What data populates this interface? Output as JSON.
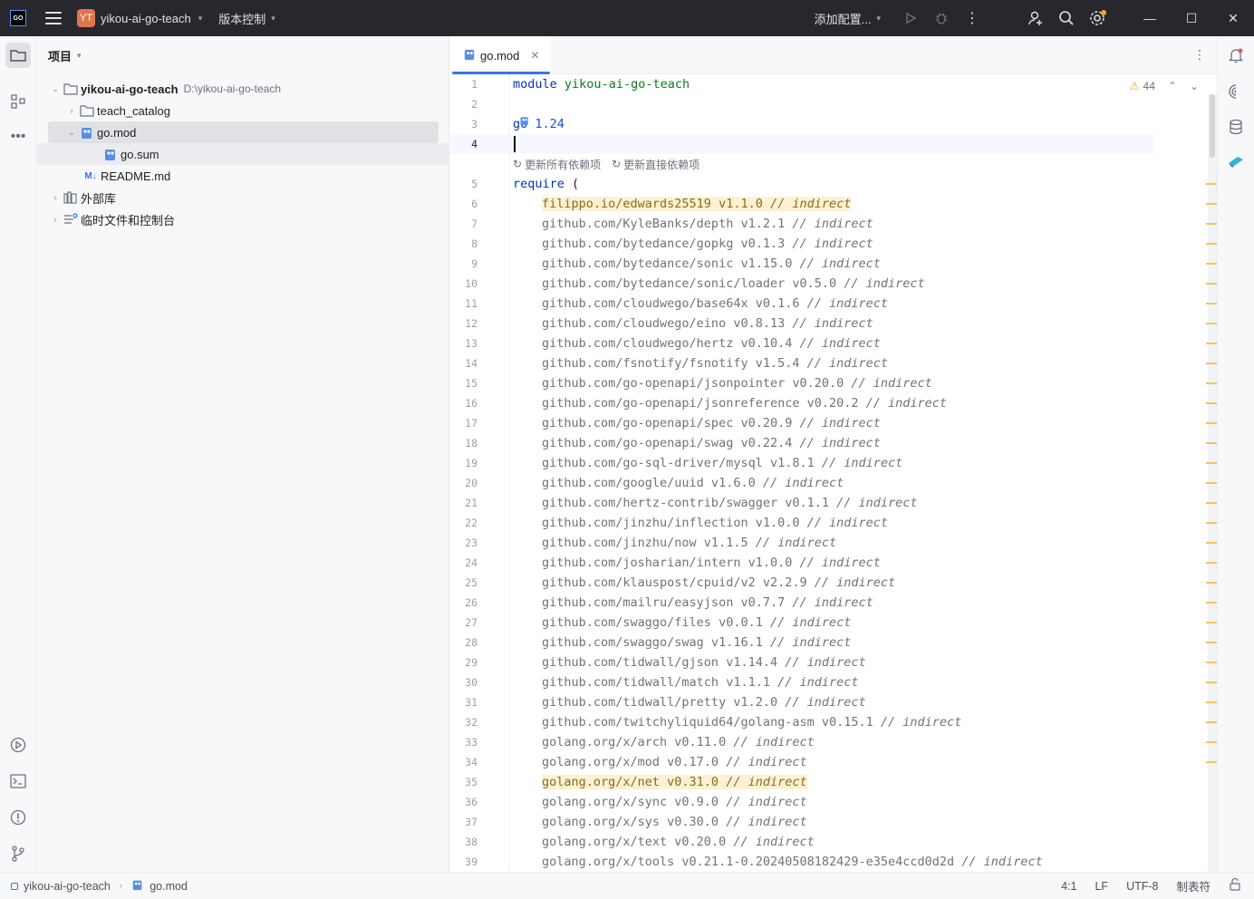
{
  "titlebar": {
    "project_badge": "YT",
    "project_name": "yikou-ai-go-teach",
    "vcs_label": "版本控制",
    "run_config": "添加配置..."
  },
  "project_panel": {
    "title": "项目",
    "root": {
      "name": "yikou-ai-go-teach",
      "path": "D:\\yikou-ai-go-teach"
    },
    "items": [
      {
        "label": "teach_catalog"
      },
      {
        "label": "go.mod"
      },
      {
        "label": "go.sum"
      },
      {
        "label": "README.md"
      },
      {
        "label": "外部库"
      },
      {
        "label": "临时文件和控制台"
      }
    ]
  },
  "editor": {
    "tab_label": "go.mod",
    "warning_count": "44",
    "inlay_actions": [
      "更新所有依赖项",
      "更新直接依赖项"
    ],
    "line_numbers": [
      "1",
      "2",
      "3",
      "4",
      "5",
      "6",
      "7",
      "8",
      "9",
      "10",
      "11",
      "12",
      "13",
      "14",
      "15",
      "16",
      "17",
      "18",
      "19",
      "20",
      "21",
      "22",
      "23",
      "24",
      "25",
      "26",
      "27",
      "28",
      "29",
      "30",
      "31",
      "32",
      "33",
      "34",
      "35",
      "36",
      "37",
      "38",
      "39"
    ],
    "module_keyword": "module",
    "module_name": "yikou-ai-go-teach",
    "go_keyword": "go",
    "go_version": "1.24",
    "require_keyword": "require",
    "require_paren": "(",
    "comment": "// indirect",
    "dependencies": [
      {
        "mod": "filippo.io/edwards25519 v1.1.0",
        "highlight": true
      },
      {
        "mod": "github.com/KyleBanks/depth v1.2.1",
        "highlight": false
      },
      {
        "mod": "github.com/bytedance/gopkg v0.1.3",
        "highlight": false
      },
      {
        "mod": "github.com/bytedance/sonic v1.15.0",
        "highlight": false
      },
      {
        "mod": "github.com/bytedance/sonic/loader v0.5.0",
        "highlight": false
      },
      {
        "mod": "github.com/cloudwego/base64x v0.1.6",
        "highlight": false
      },
      {
        "mod": "github.com/cloudwego/eino v0.8.13",
        "highlight": false
      },
      {
        "mod": "github.com/cloudwego/hertz v0.10.4",
        "highlight": false
      },
      {
        "mod": "github.com/fsnotify/fsnotify v1.5.4",
        "highlight": false
      },
      {
        "mod": "github.com/go-openapi/jsonpointer v0.20.0",
        "highlight": false
      },
      {
        "mod": "github.com/go-openapi/jsonreference v0.20.2",
        "highlight": false
      },
      {
        "mod": "github.com/go-openapi/spec v0.20.9",
        "highlight": false
      },
      {
        "mod": "github.com/go-openapi/swag v0.22.4",
        "highlight": false
      },
      {
        "mod": "github.com/go-sql-driver/mysql v1.8.1",
        "highlight": false
      },
      {
        "mod": "github.com/google/uuid v1.6.0",
        "highlight": false
      },
      {
        "mod": "github.com/hertz-contrib/swagger v0.1.1",
        "highlight": false
      },
      {
        "mod": "github.com/jinzhu/inflection v1.0.0",
        "highlight": false
      },
      {
        "mod": "github.com/jinzhu/now v1.1.5",
        "highlight": false
      },
      {
        "mod": "github.com/josharian/intern v1.0.0",
        "highlight": false
      },
      {
        "mod": "github.com/klauspost/cpuid/v2 v2.2.9",
        "highlight": false
      },
      {
        "mod": "github.com/mailru/easyjson v0.7.7",
        "highlight": false
      },
      {
        "mod": "github.com/swaggo/files v0.0.1",
        "highlight": false
      },
      {
        "mod": "github.com/swaggo/swag v1.16.1",
        "highlight": false
      },
      {
        "mod": "github.com/tidwall/gjson v1.14.4",
        "highlight": false
      },
      {
        "mod": "github.com/tidwall/match v1.1.1",
        "highlight": false
      },
      {
        "mod": "github.com/tidwall/pretty v1.2.0",
        "highlight": false
      },
      {
        "mod": "github.com/twitchyliquid64/golang-asm v0.15.1",
        "highlight": false
      },
      {
        "mod": "golang.org/x/arch v0.11.0",
        "highlight": false
      },
      {
        "mod": "golang.org/x/mod v0.17.0",
        "highlight": false
      },
      {
        "mod": "golang.org/x/net v0.31.0",
        "highlight": true
      },
      {
        "mod": "golang.org/x/sync v0.9.0",
        "highlight": false
      },
      {
        "mod": "golang.org/x/sys v0.30.0",
        "highlight": false
      },
      {
        "mod": "golang.org/x/text v0.20.0",
        "highlight": false
      },
      {
        "mod": "golang.org/x/tools v0.21.1-0.20240508182429-e35e4ccd0d2d",
        "highlight": false
      }
    ]
  },
  "statusbar": {
    "crumb_project": "yikou-ai-go-teach",
    "crumb_file": "go.mod",
    "position": "4:1",
    "line_sep": "LF",
    "encoding": "UTF-8",
    "indent": "制表符"
  }
}
